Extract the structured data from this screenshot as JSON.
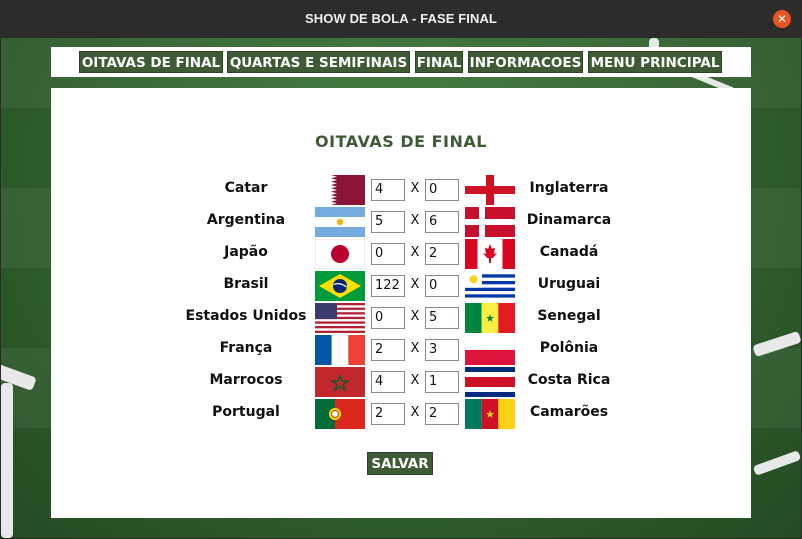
{
  "window": {
    "title": "SHOW DE BOLA - FASE FINAL"
  },
  "menu": {
    "items": [
      "OITAVAS DE FINAL",
      "QUARTAS E SEMIFINAIS",
      "FINAL",
      "INFORMACOES",
      "MENU PRINCIPAL"
    ]
  },
  "panel": {
    "title": "OITAVAS DE FINAL"
  },
  "matches": [
    {
      "home": "Catar",
      "home_flag": "qatar",
      "home_score": "4",
      "sep": "X",
      "away_score": "0",
      "away": "Inglaterra",
      "away_flag": "england"
    },
    {
      "home": "Argentina",
      "home_flag": "argentina",
      "home_score": "5",
      "sep": "X",
      "away_score": "6",
      "away": "Dinamarca",
      "away_flag": "denmark"
    },
    {
      "home": "Japão",
      "home_flag": "japan",
      "home_score": "0",
      "sep": "X",
      "away_score": "2",
      "away": "Canadá",
      "away_flag": "canada"
    },
    {
      "home": "Brasil",
      "home_flag": "brazil",
      "home_score": "122",
      "sep": "X",
      "away_score": "0",
      "away": "Uruguai",
      "away_flag": "uruguay"
    },
    {
      "home": "Estados Unidos",
      "home_flag": "usa",
      "home_score": "0",
      "sep": "X",
      "away_score": "5",
      "away": "Senegal",
      "away_flag": "senegal"
    },
    {
      "home": "França",
      "home_flag": "france",
      "home_score": "2",
      "sep": "X",
      "away_score": "3",
      "away": "Polônia",
      "away_flag": "poland"
    },
    {
      "home": "Marrocos",
      "home_flag": "morocco",
      "home_score": "4",
      "sep": "X",
      "away_score": "1",
      "away": "Costa Rica",
      "away_flag": "costa-rica"
    },
    {
      "home": "Portugal",
      "home_flag": "portugal",
      "home_score": "2",
      "sep": "X",
      "away_score": "2",
      "away": "Camarões",
      "away_flag": "cameroon"
    }
  ],
  "save_label": "SALVAR",
  "colors": {
    "accent": "#3f5b35",
    "titlebar": "#2c2c2c",
    "close": "#e95420"
  }
}
